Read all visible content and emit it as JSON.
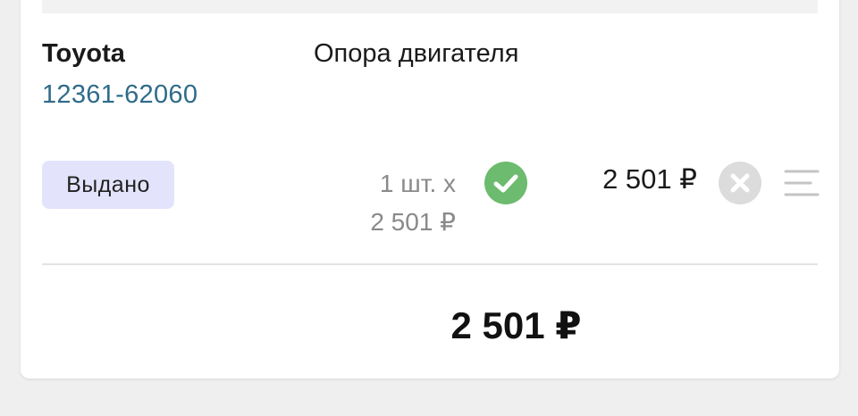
{
  "item": {
    "brand": "Toyota",
    "part_number": "12361-62060",
    "part_name": "Опора двигателя",
    "status": "Выдано",
    "quantity_line": "1 шт. х",
    "unit_price": "2 501 ₽",
    "price": "2 501 ₽"
  },
  "total": "2 501 ₽",
  "icons": {
    "confirmed": "check-circle-icon",
    "remove": "close-circle-icon",
    "menu": "drag-handle-icon"
  },
  "colors": {
    "part_number": "#2f6b8a",
    "status_badge_bg": "#e3e4fb",
    "check_green": "#6cbb6f",
    "remove_gray": "#dcdcdc"
  }
}
